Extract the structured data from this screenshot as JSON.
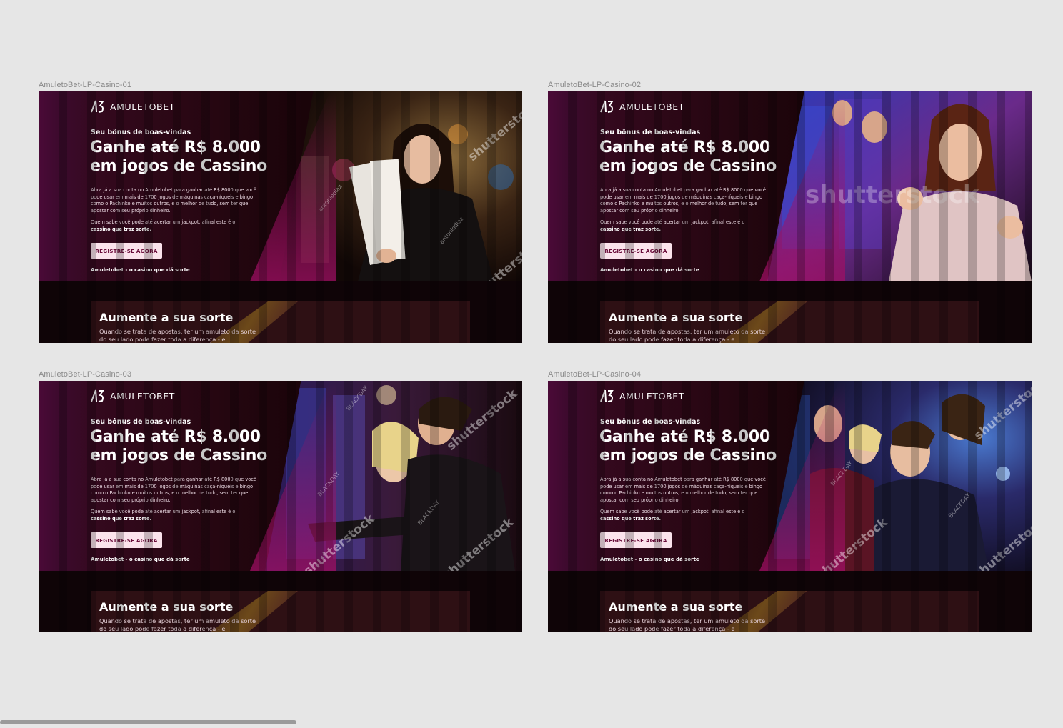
{
  "frames": [
    {
      "label": "AmuletoBet-LP-Casino-01",
      "watermarks": [
        "shutterstock",
        "antoniodiaz"
      ]
    },
    {
      "label": "AmuletoBet-LP-Casino-02",
      "watermarks": [
        "shutterstock"
      ]
    },
    {
      "label": "AmuletoBet-LP-Casino-03",
      "watermarks": [
        "shutterstock",
        "BLACKDAY"
      ]
    },
    {
      "label": "AmuletoBet-LP-Casino-04",
      "watermarks": [
        "shutterstock",
        "BLACKDAY"
      ]
    }
  ],
  "brand": {
    "name": "AMULETOBET",
    "logo_icon": "amuletobet-logo-icon"
  },
  "hero": {
    "kicker": "Seu bônus de boas-vindas",
    "headline_line1": "Ganhe até R$ 8.000",
    "headline_line2": "em jogos de Cassino",
    "body": "Abra já a sua conta no Amuletobet para ganhar até R$ 8000 que você pode usar em mais de 1700 jogos de máquinas caça-níqueis e bingo como o Pachinko e muitos outros, e o melhor de tudo, sem ter que apostar com seu próprio dinheiro.",
    "body2_prefix": "Quem sabe você pode até acertar um jackpot, afinal este é o",
    "body2_bold": "cassino que traz sorte.",
    "cta": "REGISTRE-SE AGORA",
    "tagline": "Amuletobet - o casino que dá sorte"
  },
  "lower": {
    "title": "Aumente a sua sorte",
    "body": "Quando se trata de apostas, ter um amuleto da sorte do seu lado pode fazer toda a diferença - e"
  },
  "colors": {
    "accent": "#fbe3ec",
    "cta_text": "#6a0d3a",
    "background": "#e6e6e6",
    "hero_dark": "#1a0409",
    "magenta": "#5e0b46"
  }
}
